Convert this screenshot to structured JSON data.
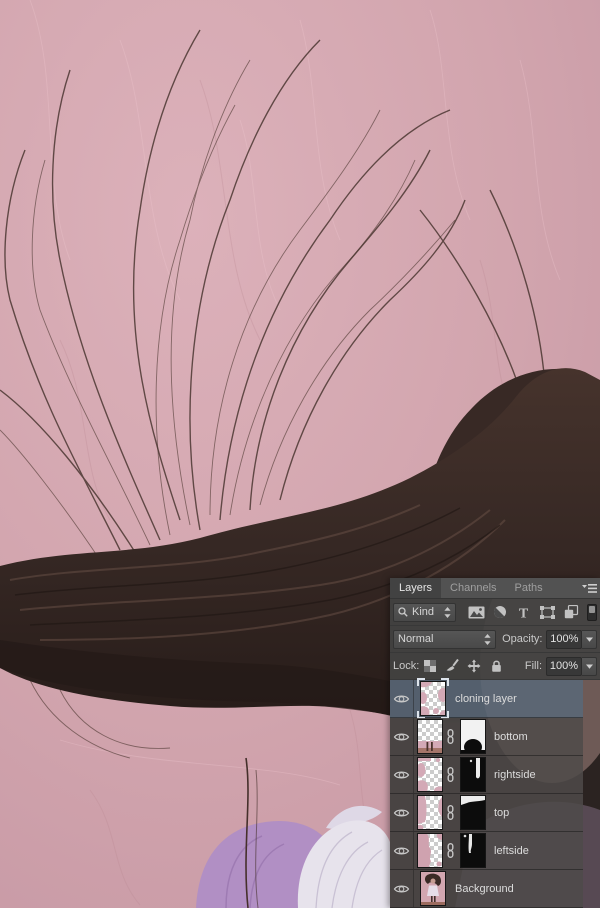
{
  "panel": {
    "tabs": [
      {
        "label": "Layers",
        "active": true
      },
      {
        "label": "Channels",
        "active": false
      },
      {
        "label": "Paths",
        "active": false
      }
    ],
    "filter": {
      "kind_label": "Kind"
    },
    "blend": {
      "mode": "Normal",
      "opacity_label": "Opacity:",
      "opacity_value": "100%"
    },
    "lock": {
      "label": "Lock:",
      "fill_label": "Fill:",
      "fill_value": "100%"
    },
    "rows": [
      {
        "label": "cloning layer",
        "selected": true,
        "has_mask": false
      },
      {
        "label": "bottom",
        "selected": false,
        "has_mask": true
      },
      {
        "label": "rightside",
        "selected": false,
        "has_mask": true
      },
      {
        "label": "top",
        "selected": false,
        "has_mask": true
      },
      {
        "label": "leftside",
        "selected": false,
        "has_mask": true
      },
      {
        "label": "Background",
        "selected": false,
        "has_mask": false
      }
    ]
  },
  "colors": {
    "selected_row": "#56626E",
    "panel_chrome": "#424242",
    "tab_bar": "#525252",
    "photo_pink": "#d2a5ae",
    "hair_brown": "#382a27",
    "garment_lavender": "#b18fc4",
    "thumb_pink": "#d3a9b6"
  }
}
